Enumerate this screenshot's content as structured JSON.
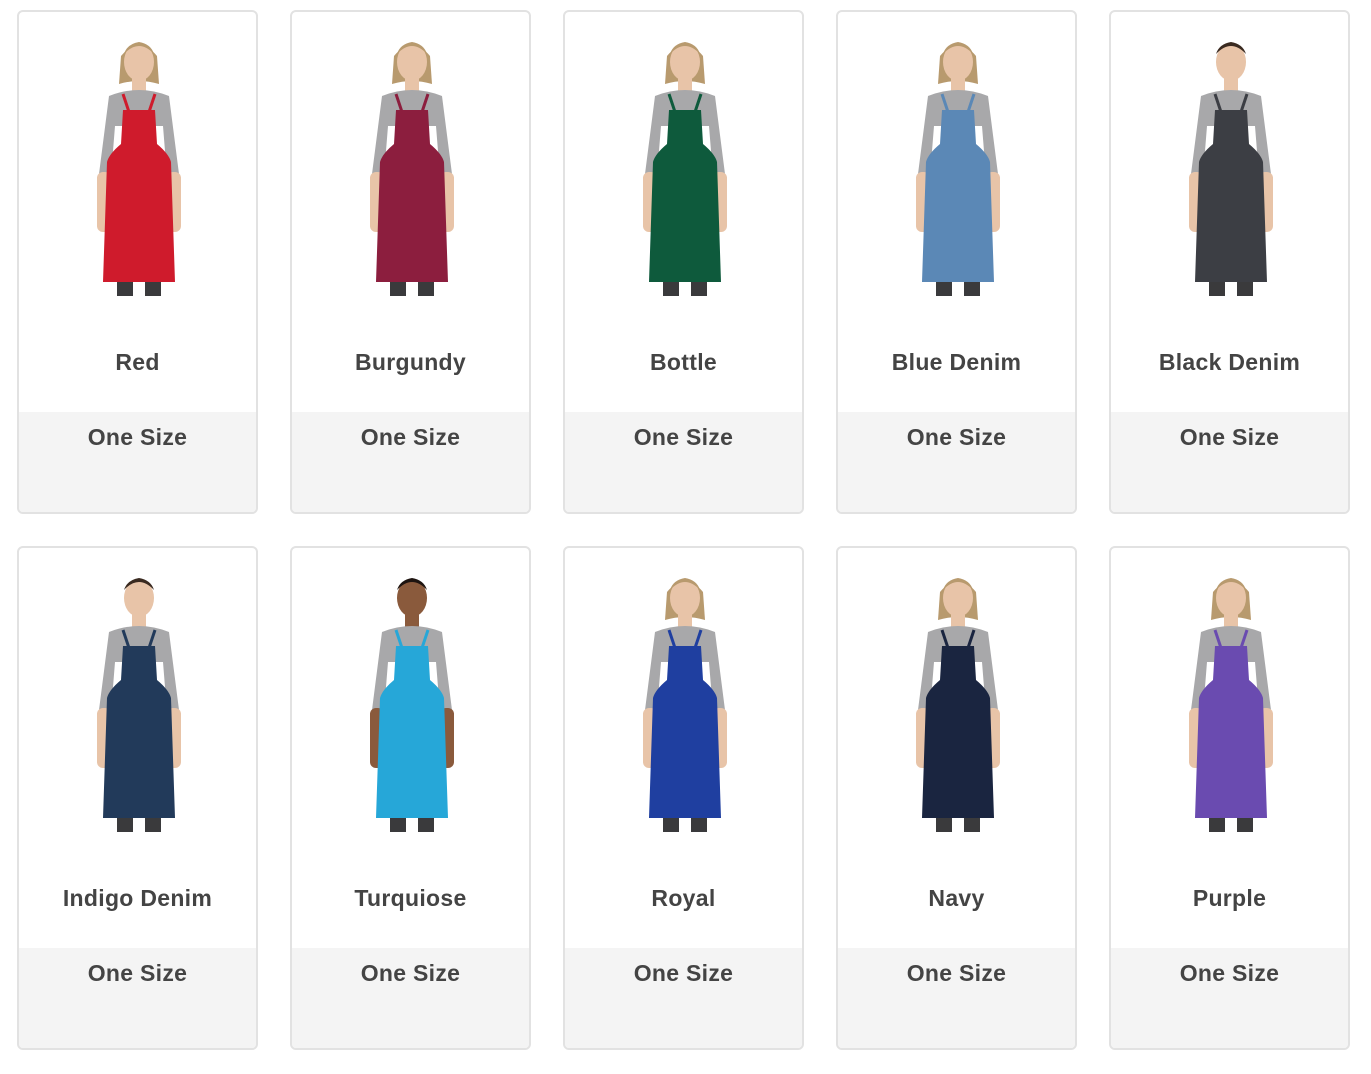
{
  "products": [
    {
      "color_name": "Red",
      "size": "One Size",
      "apron_color": "#cf1b2c",
      "model": "female"
    },
    {
      "color_name": "Burgundy",
      "size": "One Size",
      "apron_color": "#8c1e3e",
      "model": "female"
    },
    {
      "color_name": "Bottle",
      "size": "One Size",
      "apron_color": "#0e5a3c",
      "model": "female"
    },
    {
      "color_name": "Blue Denim",
      "size": "One Size",
      "apron_color": "#5b88b6",
      "model": "female"
    },
    {
      "color_name": "Black Denim",
      "size": "One Size",
      "apron_color": "#3c3e44",
      "model": "male"
    },
    {
      "color_name": "Indigo Denim",
      "size": "One Size",
      "apron_color": "#223a5a",
      "model": "male"
    },
    {
      "color_name": "Turquiose",
      "size": "One Size",
      "apron_color": "#26a7d8",
      "model": "male-dark"
    },
    {
      "color_name": "Royal",
      "size": "One Size",
      "apron_color": "#1f3fa0",
      "model": "female"
    },
    {
      "color_name": "Navy",
      "size": "One Size",
      "apron_color": "#1a2540",
      "model": "female"
    },
    {
      "color_name": "Purple",
      "size": "One Size",
      "apron_color": "#6a4bb0",
      "model": "female"
    }
  ]
}
